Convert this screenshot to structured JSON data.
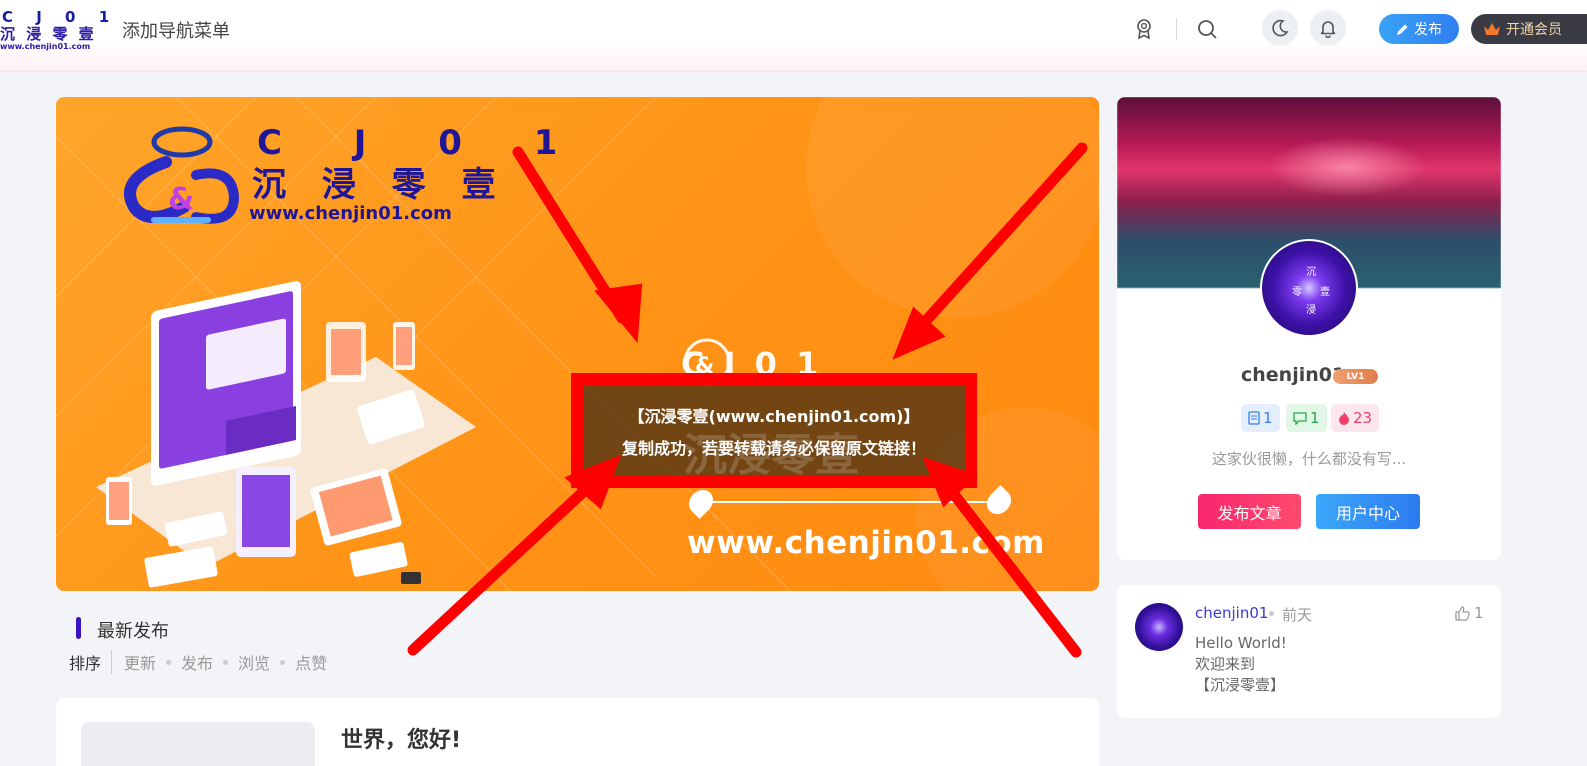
{
  "header": {
    "logo": {
      "line1": "C J 0 1",
      "line2": "沉 浸 零 壹",
      "line3": "www.chenjin01.com"
    },
    "nav_add": "添加导航菜单",
    "publish_label": "发布",
    "vip_label": "开通会员"
  },
  "banner": {
    "logo_line1": "C J 0 1",
    "logo_line2": "沉 浸 零 壹",
    "logo_url": "www.chenjin01.com",
    "mid_logo": "C J 0 1",
    "url": "www.chenjin01.com"
  },
  "toast": {
    "line1": "【沉浸零壹(www.chenjin01.com)】",
    "line2": "复制成功，若要转载请务必保留原文链接！",
    "watermark": "沉浸零壹"
  },
  "latest": {
    "title": "最新发布",
    "sort_label": "排序",
    "sort_options": [
      "更新",
      "发布",
      "浏览",
      "点赞"
    ]
  },
  "post": {
    "title": "世界，您好!"
  },
  "profile": {
    "username": "chenjin01",
    "level": "LV1",
    "avatar_text": [
      "沉",
      "零",
      "壹",
      "浸"
    ],
    "stats": {
      "posts": "1",
      "comments": "1",
      "hot": "23"
    },
    "bio": "这家伙很懒，什么都没有写...",
    "publish_btn": "发布文章",
    "user_center_btn": "用户中心"
  },
  "comment": {
    "user": "chenjin01",
    "time": "前天",
    "likes": "1",
    "lines": [
      "Hello World!",
      "欢迎来到",
      "【沉浸零壹】"
    ]
  },
  "colors": {
    "accent": "#3a13c4",
    "banner_orange": "#ff9417",
    "arrow_red": "#ff0000",
    "publish_blue": "#2f7ff0"
  }
}
